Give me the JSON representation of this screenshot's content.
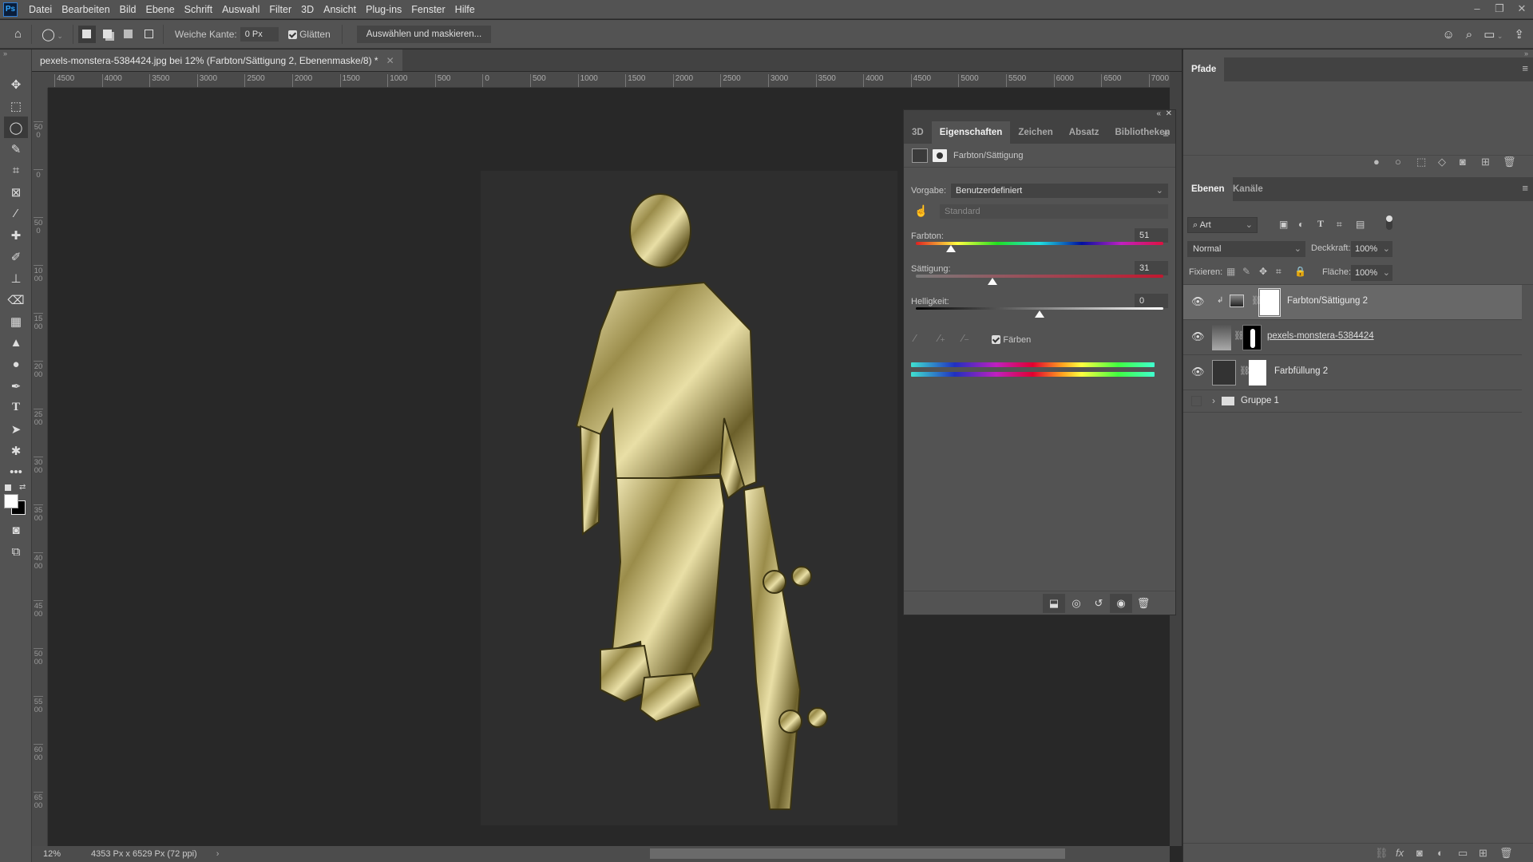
{
  "app": {
    "logo": "Ps"
  },
  "menubar": {
    "items": [
      "Datei",
      "Bearbeiten",
      "Bild",
      "Ebene",
      "Schrift",
      "Auswahl",
      "Filter",
      "3D",
      "Ansicht",
      "Plug-ins",
      "Fenster",
      "Hilfe"
    ]
  },
  "window_controls": {
    "minimize": "–",
    "restore": "❐",
    "close": "✕"
  },
  "options": {
    "feather_label": "Weiche Kante:",
    "feather_value": "0 Px",
    "smooth_label": "Glätten",
    "smooth_checked": true,
    "select_mask_label": "Auswählen und maskieren..."
  },
  "document": {
    "tab_title": "pexels-monstera-5384424.jpg bei 12% (Farbton/Sättigung 2, Ebenenmaske/8) *",
    "zoom": "12%",
    "info": "4353 Px x 6529 Px (72 ppi)"
  },
  "ruler": {
    "horizontal": [
      "4500",
      "4000",
      "3500",
      "3000",
      "2500",
      "2000",
      "1500",
      "1000",
      "500",
      "0",
      "500",
      "1000",
      "1500",
      "2000",
      "2500",
      "3000",
      "3500",
      "4000",
      "4500",
      "5000",
      "5500",
      "6000",
      "6500",
      "7000"
    ],
    "vertical": [
      "500",
      "0",
      "500",
      "1000",
      "1500",
      "2000",
      "2500",
      "3000",
      "3500",
      "4000",
      "4500",
      "5000",
      "5500",
      "6000",
      "6500"
    ]
  },
  "properties": {
    "tabs": [
      "3D",
      "Eigenschaften",
      "Zeichen",
      "Absatz",
      "Bibliotheken"
    ],
    "active_tab": "Eigenschaften",
    "title": "Farbton/Sättigung",
    "preset_label": "Vorgabe:",
    "preset_value": "Benutzerdefiniert",
    "channel_value": "Standard",
    "hue_label": "Farbton:",
    "hue_value": "51",
    "hue_fraction": 0.142,
    "saturation_label": "Sättigung:",
    "saturation_value": "31",
    "saturation_fraction": 0.31,
    "lightness_label": "Helligkeit:",
    "lightness_value": "0",
    "lightness_fraction": 0.5,
    "colorize_label": "Färben",
    "colorize_checked": true
  },
  "paths_panel": {
    "tab": "Pfade"
  },
  "layers_panel": {
    "tabs": [
      "Ebenen",
      "Kanäle"
    ],
    "active_tab": "Ebenen",
    "filter_label": "Art",
    "blend_mode": "Normal",
    "opacity_label": "Deckkraft:",
    "opacity_value": "100%",
    "lock_label": "Fixieren:",
    "fill_label": "Fläche:",
    "fill_value": "100%",
    "layers": [
      {
        "name": "Farbton/Sättigung 2",
        "visible": true,
        "selected": true
      },
      {
        "name": "pexels-monstera-5384424",
        "visible": true,
        "selected": false
      },
      {
        "name": "Farbfüllung 2",
        "visible": true,
        "selected": false
      },
      {
        "name": "Gruppe 1",
        "visible": false,
        "selected": false
      }
    ]
  }
}
